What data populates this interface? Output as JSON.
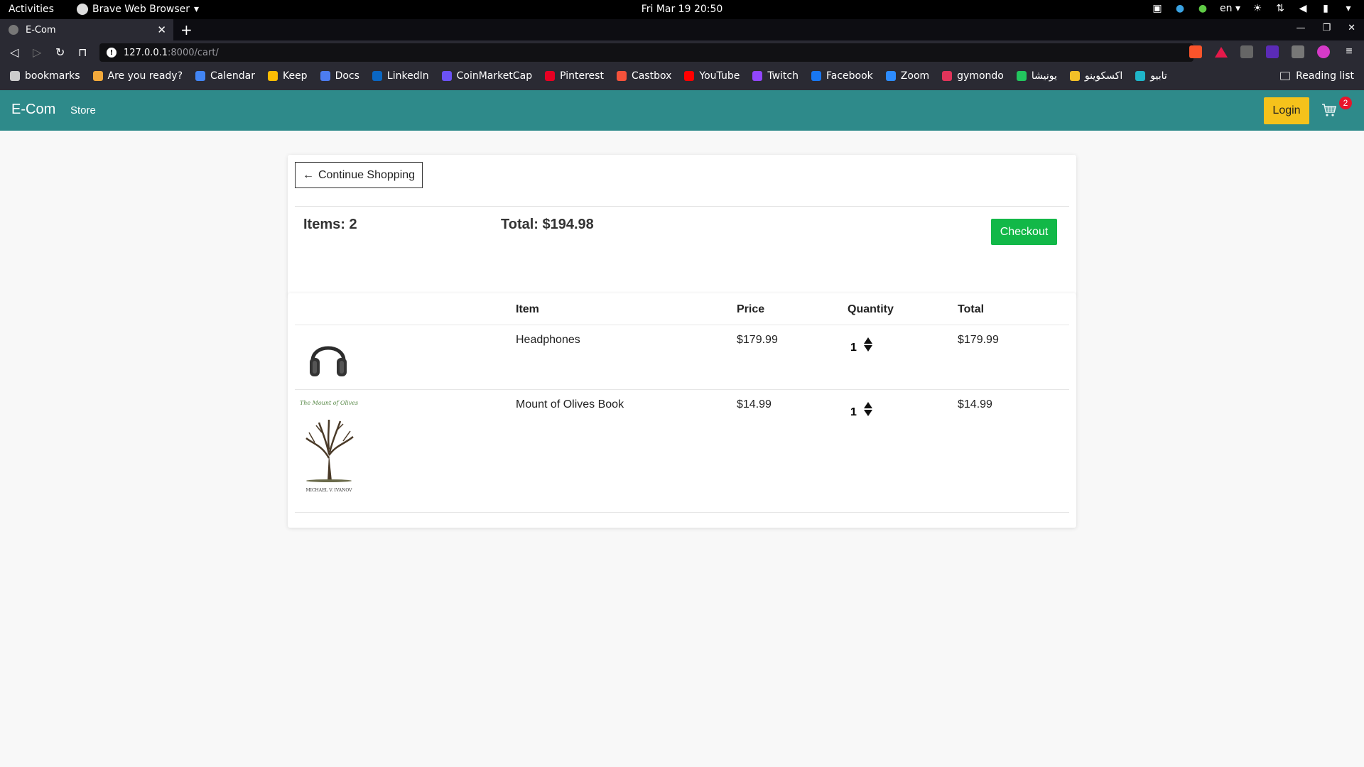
{
  "os_bar": {
    "activities": "Activities",
    "app_name": "Brave Web Browser",
    "datetime": "Fri Mar 19  20:50",
    "language": "en"
  },
  "browser": {
    "tab_title": "E-Com",
    "url_host": "127.0.0.1",
    "url_path": ":8000/cart/",
    "bookmarks": [
      {
        "label": "bookmarks",
        "icon": "folder-icon",
        "color": "#cccccc"
      },
      {
        "label": "Are you ready?",
        "icon": "emoji-icon",
        "color": "#f2a93b"
      },
      {
        "label": "Calendar",
        "icon": "calendar-icon",
        "color": "#4285f4"
      },
      {
        "label": "Keep",
        "icon": "keep-icon",
        "color": "#fbbc04"
      },
      {
        "label": "Docs",
        "icon": "docs-icon",
        "color": "#4c7cf0"
      },
      {
        "label": "LinkedIn",
        "icon": "linkedin-icon",
        "color": "#0a66c2"
      },
      {
        "label": "CoinMarketCap",
        "icon": "coinmarketcap-icon",
        "color": "#6b52f5"
      },
      {
        "label": "Pinterest",
        "icon": "pinterest-icon",
        "color": "#e60023"
      },
      {
        "label": "Castbox",
        "icon": "castbox-icon",
        "color": "#f4523b"
      },
      {
        "label": "YouTube",
        "icon": "youtube-icon",
        "color": "#ff0000"
      },
      {
        "label": "Twitch",
        "icon": "twitch-icon",
        "color": "#9146ff"
      },
      {
        "label": "Facebook",
        "icon": "facebook-icon",
        "color": "#1877f2"
      },
      {
        "label": "Zoom",
        "icon": "zoom-icon",
        "color": "#2d8cff"
      },
      {
        "label": "gymondo",
        "icon": "gymondo-icon",
        "color": "#e0345a"
      },
      {
        "label": "یونیشا",
        "icon": "bookmark-icon",
        "color": "#22c55e"
      },
      {
        "label": "اکسکوینو",
        "icon": "bookmark-icon",
        "color": "#f2c028"
      },
      {
        "label": "تابیو",
        "icon": "bookmark-icon",
        "color": "#1fb5c9"
      }
    ],
    "reading_list": "Reading list"
  },
  "site": {
    "brand": "E-Com",
    "store_link": "Store",
    "login": "Login",
    "cart_count": "2",
    "nav_color": "#2e8a8a"
  },
  "cart": {
    "continue_label": "Continue Shopping",
    "items_label": "Items: 2",
    "total_label": "Total: $194.98",
    "checkout_label": "Checkout",
    "columns": [
      "Item",
      "Price",
      "Quantity",
      "Total"
    ],
    "rows": [
      {
        "image": "headphones-image",
        "name": "Headphones",
        "price": "$179.99",
        "quantity": "1",
        "total": "$179.99"
      },
      {
        "image": "book-cover-image",
        "name": "Mount of Olives Book",
        "price": "$14.99",
        "quantity": "1",
        "total": "$14.99"
      }
    ],
    "book_cover_title": "The Mount of Olives",
    "book_cover_author": "MICHAEL V. IVANOV"
  }
}
